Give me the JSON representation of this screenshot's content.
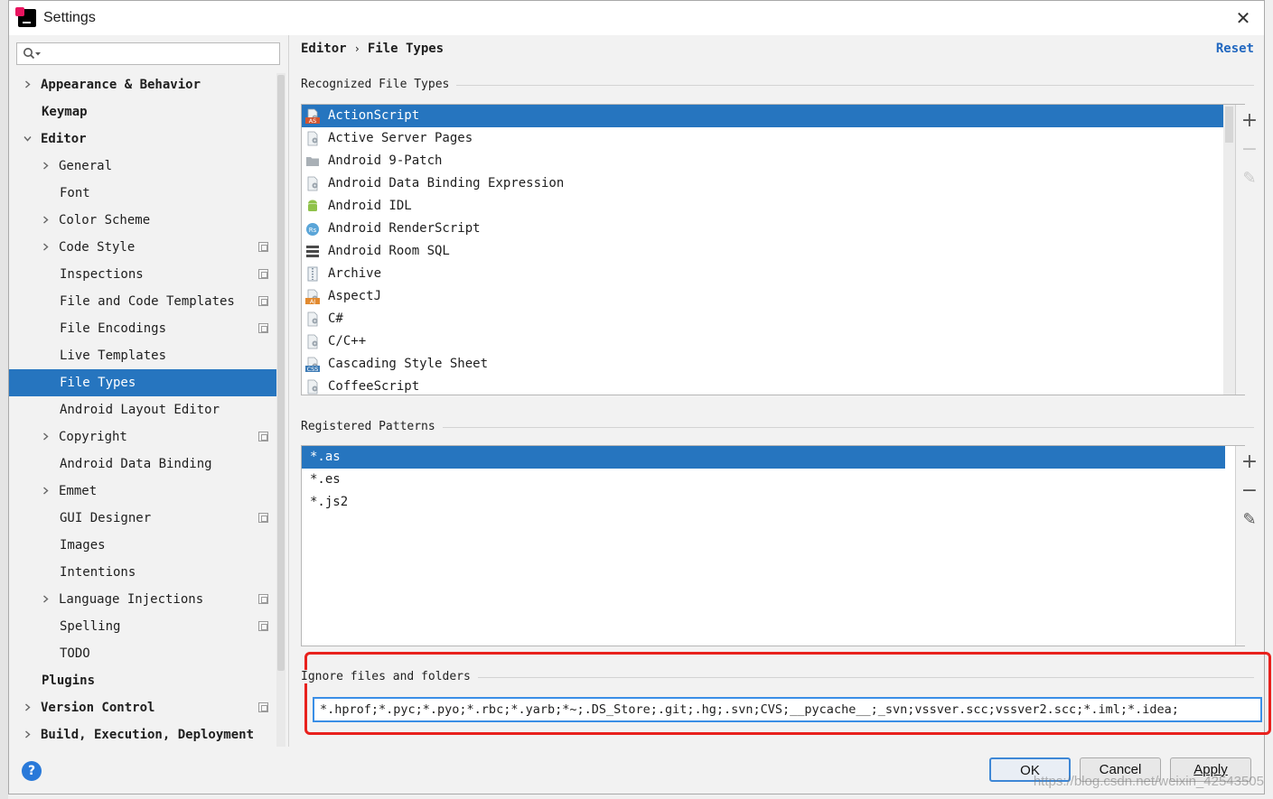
{
  "window": {
    "title": "Settings",
    "close_symbol": "✕"
  },
  "search": {
    "placeholder": ""
  },
  "sidebar": {
    "items": [
      {
        "label": "Appearance & Behavior",
        "level": 0,
        "arrow": "right",
        "bold": true,
        "copy": false,
        "selected": false
      },
      {
        "label": "Keymap",
        "level": 0,
        "arrow": "",
        "bold": true,
        "copy": false,
        "selected": false
      },
      {
        "label": "Editor",
        "level": 0,
        "arrow": "down",
        "bold": true,
        "copy": false,
        "selected": false
      },
      {
        "label": "General",
        "level": 1,
        "arrow": "right",
        "bold": false,
        "copy": false,
        "selected": false
      },
      {
        "label": "Font",
        "level": 1,
        "arrow": "",
        "bold": false,
        "copy": false,
        "selected": false
      },
      {
        "label": "Color Scheme",
        "level": 1,
        "arrow": "right",
        "bold": false,
        "copy": false,
        "selected": false
      },
      {
        "label": "Code Style",
        "level": 1,
        "arrow": "right",
        "bold": false,
        "copy": true,
        "selected": false
      },
      {
        "label": "Inspections",
        "level": 1,
        "arrow": "",
        "bold": false,
        "copy": true,
        "selected": false
      },
      {
        "label": "File and Code Templates",
        "level": 1,
        "arrow": "",
        "bold": false,
        "copy": true,
        "selected": false
      },
      {
        "label": "File Encodings",
        "level": 1,
        "arrow": "",
        "bold": false,
        "copy": true,
        "selected": false
      },
      {
        "label": "Live Templates",
        "level": 1,
        "arrow": "",
        "bold": false,
        "copy": false,
        "selected": false
      },
      {
        "label": "File Types",
        "level": 1,
        "arrow": "",
        "bold": false,
        "copy": false,
        "selected": true
      },
      {
        "label": "Android Layout Editor",
        "level": 1,
        "arrow": "",
        "bold": false,
        "copy": false,
        "selected": false
      },
      {
        "label": "Copyright",
        "level": 1,
        "arrow": "right",
        "bold": false,
        "copy": true,
        "selected": false
      },
      {
        "label": "Android Data Binding",
        "level": 1,
        "arrow": "",
        "bold": false,
        "copy": false,
        "selected": false
      },
      {
        "label": "Emmet",
        "level": 1,
        "arrow": "right",
        "bold": false,
        "copy": false,
        "selected": false
      },
      {
        "label": "GUI Designer",
        "level": 1,
        "arrow": "",
        "bold": false,
        "copy": true,
        "selected": false
      },
      {
        "label": "Images",
        "level": 1,
        "arrow": "",
        "bold": false,
        "copy": false,
        "selected": false
      },
      {
        "label": "Intentions",
        "level": 1,
        "arrow": "",
        "bold": false,
        "copy": false,
        "selected": false
      },
      {
        "label": "Language Injections",
        "level": 1,
        "arrow": "right",
        "bold": false,
        "copy": true,
        "selected": false
      },
      {
        "label": "Spelling",
        "level": 1,
        "arrow": "",
        "bold": false,
        "copy": true,
        "selected": false
      },
      {
        "label": "TODO",
        "level": 1,
        "arrow": "",
        "bold": false,
        "copy": false,
        "selected": false
      },
      {
        "label": "Plugins",
        "level": 0,
        "arrow": "",
        "bold": true,
        "copy": false,
        "selected": false
      },
      {
        "label": "Version Control",
        "level": 0,
        "arrow": "right",
        "bold": true,
        "copy": true,
        "selected": false
      },
      {
        "label": "Build, Execution, Deployment",
        "level": 0,
        "arrow": "right",
        "bold": true,
        "copy": false,
        "selected": false
      }
    ]
  },
  "help": {
    "label": "?"
  },
  "breadcrumb": {
    "parent": "Editor",
    "separator": "›",
    "current": "File Types"
  },
  "reset_label": "Reset",
  "recognized": {
    "title": "Recognized File Types",
    "items": [
      {
        "label": "ActionScript",
        "icon": "actionscript-icon",
        "badge": "AS",
        "badge_color": "#d2542f"
      },
      {
        "label": "Active Server Pages",
        "icon": "file-gear-icon",
        "badge": "",
        "badge_color": ""
      },
      {
        "label": "Android 9-Patch",
        "icon": "folder-icon",
        "badge": "",
        "badge_color": ""
      },
      {
        "label": "Android Data Binding Expression",
        "icon": "file-gear-icon",
        "badge": "",
        "badge_color": ""
      },
      {
        "label": "Android IDL",
        "icon": "android-icon",
        "badge": "",
        "badge_color": ""
      },
      {
        "label": "Android RenderScript",
        "icon": "renderscript-icon",
        "badge": "Rs",
        "badge_color": "#5aa5d8"
      },
      {
        "label": "Android Room SQL",
        "icon": "database-icon",
        "badge": "",
        "badge_color": ""
      },
      {
        "label": "Archive",
        "icon": "archive-icon",
        "badge": "",
        "badge_color": ""
      },
      {
        "label": "AspectJ",
        "icon": "aspectj-icon",
        "badge": "AJ",
        "badge_color": "#e28a2f"
      },
      {
        "label": "C#",
        "icon": "file-gear-icon",
        "badge": "",
        "badge_color": ""
      },
      {
        "label": "C/C++",
        "icon": "file-gear-icon",
        "badge": "",
        "badge_color": ""
      },
      {
        "label": "Cascading Style Sheet",
        "icon": "css-icon",
        "badge": "CSS",
        "badge_color": "#3c7ab5"
      },
      {
        "label": "CoffeeScript",
        "icon": "coffeescript-icon",
        "badge": "",
        "badge_color": ""
      }
    ]
  },
  "patterns": {
    "title": "Registered Patterns",
    "items": [
      {
        "label": "*.as",
        "selected": true
      },
      {
        "label": "*.es",
        "selected": false
      },
      {
        "label": "*.js2",
        "selected": false
      }
    ]
  },
  "toolbar": {
    "add": "+",
    "remove": "−",
    "edit": "✎"
  },
  "ignore": {
    "title": "Ignore files and folders",
    "value": "*.hprof;*.pyc;*.pyo;*.rbc;*.yarb;*~;.DS_Store;.git;.hg;.svn;CVS;__pycache__;_svn;vssver.scc;vssver2.scc;*.iml;*.idea;"
  },
  "buttons": {
    "ok": "OK",
    "cancel": "Cancel",
    "apply": "Apply"
  },
  "watermark": "https://blog.csdn.net/weixin_42543505",
  "colors": {
    "selection": "#2675bf",
    "link": "#2268c0",
    "highlight_border": "#e8211d"
  }
}
